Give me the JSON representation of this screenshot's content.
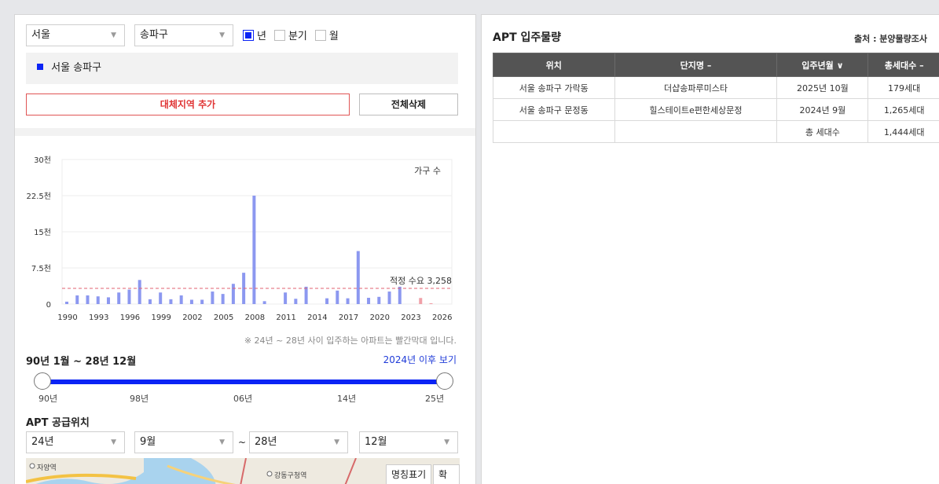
{
  "filters": {
    "city": "서울",
    "district": "송파구",
    "periods": [
      {
        "label": "년",
        "checked": true
      },
      {
        "label": "분기",
        "checked": false
      },
      {
        "label": "월",
        "checked": false
      }
    ]
  },
  "selected_region": "서울 송파구",
  "buttons": {
    "add_region": "대체지역 추가",
    "clear_all": "전체삭제"
  },
  "chart_data": {
    "type": "bar",
    "series_label": "가구 수",
    "y_ticks": [
      "30천",
      "22.5천",
      "15천",
      "7.5천",
      "0"
    ],
    "x_ticks": [
      "1990",
      "1993",
      "1996",
      "1999",
      "2002",
      "2005",
      "2008",
      "2011",
      "2014",
      "2017",
      "2020",
      "2023",
      "2026"
    ],
    "ylim": [
      0,
      30000
    ],
    "x": [
      1990,
      1991,
      1992,
      1993,
      1994,
      1995,
      1996,
      1997,
      1998,
      1999,
      2000,
      2001,
      2002,
      2003,
      2004,
      2005,
      2006,
      2007,
      2008,
      2009,
      2010,
      2011,
      2012,
      2013,
      2014,
      2015,
      2016,
      2017,
      2018,
      2019,
      2020,
      2021,
      2022,
      2023,
      2024,
      2025,
      2026
    ],
    "values": [
      500,
      1800,
      1800,
      1600,
      1400,
      2400,
      3000,
      5000,
      1000,
      2400,
      1000,
      1800,
      900,
      900,
      2600,
      2100,
      4200,
      6500,
      22500,
      600,
      0,
      2400,
      1100,
      3600,
      0,
      1200,
      2800,
      1200,
      11000,
      1300,
      1500,
      2600,
      3600,
      0,
      1265,
      179,
      0
    ],
    "highlight_from": 2024,
    "bar_color": "#8c98f0",
    "highlight_color": "#f0a0a8",
    "reference_line": {
      "value": 3258,
      "label": "적정 수요 3,258",
      "color": "#e06070"
    },
    "grid": true
  },
  "chart_note": "※ 24년 ~ 28년 사이 입주하는 아파트는 빨간막대 입니다.",
  "range": {
    "label": "90년 1월 ~ 28년 12월",
    "link": "2024년 이후 보기",
    "ticks": [
      "90년",
      "98년",
      "06년",
      "14년",
      "25년"
    ]
  },
  "supply": {
    "title": "APT 공급위치",
    "from_year": "24년",
    "from_month": "9월",
    "to_year": "28년",
    "to_month": "12월",
    "tilde": "~"
  },
  "map": {
    "btn_names": "명칭표기",
    "btn_zoom": "확대",
    "places": [
      "자양역",
      "강동구청역"
    ]
  },
  "right": {
    "title": "APT 입주물량",
    "source": "출처 : 분양물량조사",
    "headers": [
      "위치",
      "단지명 –",
      "입주년월 ∨",
      "총세대수 –"
    ],
    "rows": [
      [
        "서울 송파구 가락동",
        "더샵송파루미스타",
        "2025년 10월",
        "179세대"
      ],
      [
        "서울 송파구 문정동",
        "힐스테이트e편한세상문정",
        "2024년 9월",
        "1,265세대"
      ],
      [
        "",
        "",
        "총 세대수",
        "1,444세대"
      ]
    ]
  },
  "colors": {
    "accent": "#0b24f5",
    "danger": "#e03535",
    "header": "#545454"
  }
}
